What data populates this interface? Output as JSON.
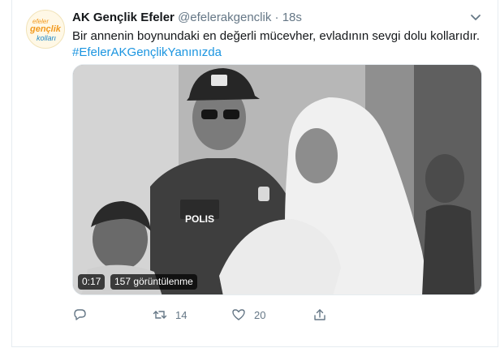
{
  "tweet": {
    "author_name": "AK Gençlik Efeler",
    "handle": "@efelerakgenclik",
    "separator": "·",
    "time": "18s",
    "text": "Bir annenin boynundaki en değerli mücevher, evladının sevgi dolu kollarıdır.",
    "hashtag": "#EfelerAKGençlikYanınızda",
    "avatar": {
      "line1": "efeler",
      "line2": "gençlik",
      "line3": "kolları"
    },
    "media": {
      "duration": "0:17",
      "views": "157 görüntülenme",
      "police_label": "POLIS"
    },
    "actions": {
      "reply_icon": "reply-icon",
      "retweet_icon": "retweet-icon",
      "retweet_count": "14",
      "like_icon": "heart-icon",
      "like_count": "20",
      "share_icon": "share-icon"
    },
    "colors": {
      "link": "#1b95e0",
      "muted": "#657786",
      "text": "#14171a"
    }
  }
}
